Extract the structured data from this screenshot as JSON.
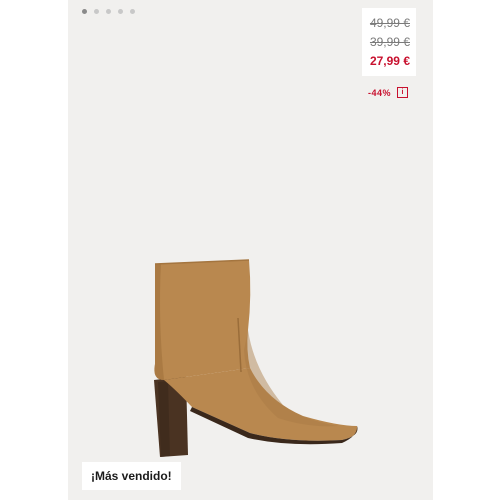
{
  "carousel": {
    "count": 5,
    "active_index": 0
  },
  "price": {
    "original": "49,99 €",
    "previous": "39,99 €",
    "current": "27,99 €",
    "discount": "-44%",
    "info_glyph": "i"
  },
  "badge": {
    "label": "¡Más vendido!"
  },
  "product": {
    "image_icon": "ankle-boot-icon"
  },
  "colors": {
    "sale": "#c8102e",
    "boot": "#b9884f"
  }
}
